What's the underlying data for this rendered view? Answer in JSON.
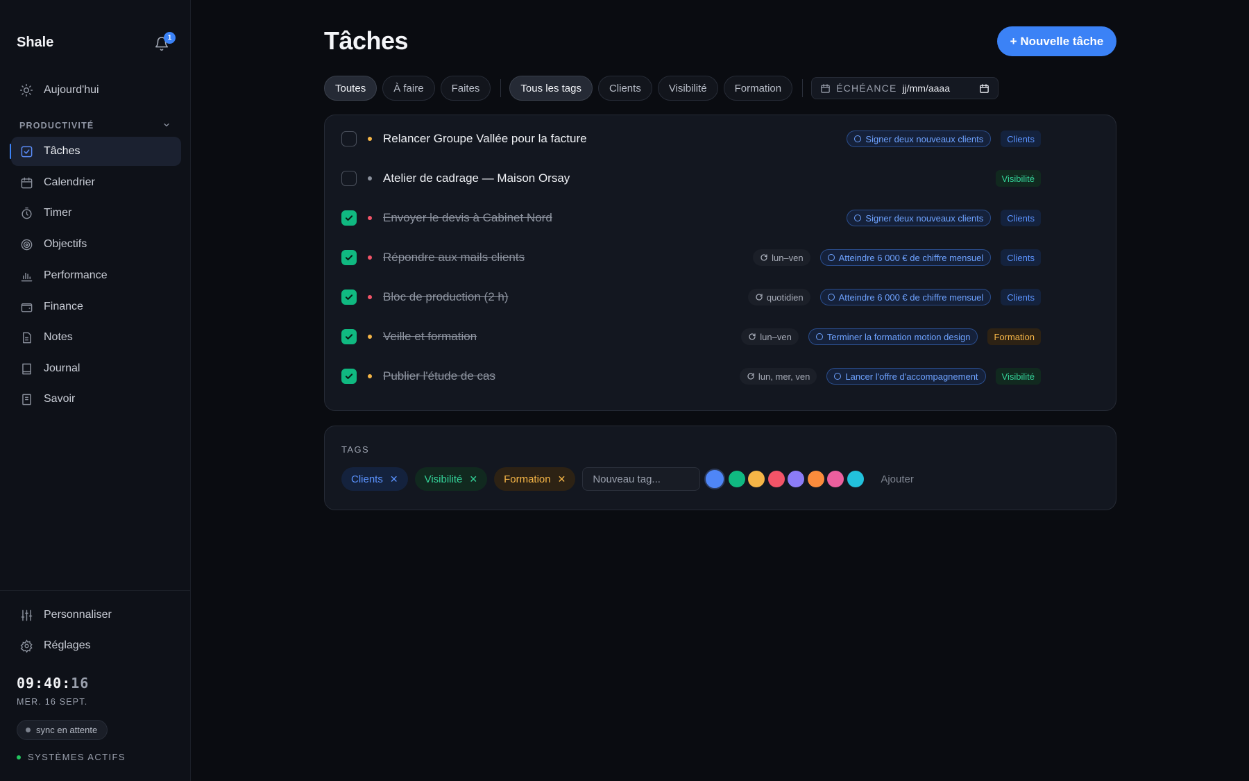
{
  "app": {
    "brand": "Shale",
    "notification_count": "1"
  },
  "sidebar": {
    "top_items": [
      {
        "label": "Aujourd'hui",
        "icon": "sun-icon"
      }
    ],
    "section_label": "PRODUCTIVITÉ",
    "items": [
      {
        "label": "Tâches",
        "icon": "check-square-icon",
        "active": true
      },
      {
        "label": "Calendrier",
        "icon": "calendar-icon"
      },
      {
        "label": "Timer",
        "icon": "stopwatch-icon"
      },
      {
        "label": "Objectifs",
        "icon": "target-icon"
      },
      {
        "label": "Performance",
        "icon": "bar-chart-icon"
      },
      {
        "label": "Finance",
        "icon": "wallet-icon"
      },
      {
        "label": "Notes",
        "icon": "document-icon"
      },
      {
        "label": "Journal",
        "icon": "book-icon"
      },
      {
        "label": "Savoir",
        "icon": "knowledge-icon"
      }
    ],
    "bottom_items": [
      {
        "label": "Personnaliser",
        "icon": "sliders-icon"
      },
      {
        "label": "Réglages",
        "icon": "gear-icon"
      }
    ],
    "clock": {
      "hm": "09:40:",
      "sec": "16"
    },
    "date": "MER. 16 SEPT.",
    "sync_status": "sync en attente",
    "systems_status": "SYSTÈMES ACTIFS"
  },
  "main": {
    "title": "Tâches",
    "new_task_label": "+ Nouvelle tâche",
    "status_filters": [
      "Toutes",
      "À faire",
      "Faites"
    ],
    "tag_filters": [
      "Tous les tags",
      "Clients",
      "Visibilité",
      "Formation"
    ],
    "due_label": "ÉCHÉANCE",
    "due_placeholder": "jj/mm/aaaa"
  },
  "tasks": [
    {
      "title": "Relancer Groupe Vallée pour la facture",
      "done": false,
      "priority_color": "#f5b547",
      "recurrence": "",
      "goal": "Signer deux nouveaux clients",
      "tag": "Clients"
    },
    {
      "title": "Atelier de cadrage — Maison Orsay",
      "done": false,
      "priority_color": "#8a909c",
      "recurrence": "",
      "goal": "",
      "tag": "Visibilité"
    },
    {
      "title": "Envoyer le devis à Cabinet Nord",
      "done": true,
      "priority_color": "#f25468",
      "recurrence": "",
      "goal": "Signer deux nouveaux clients",
      "tag": "Clients"
    },
    {
      "title": "Répondre aux mails clients",
      "done": true,
      "priority_color": "#f25468",
      "recurrence": "lun–ven",
      "goal": "Atteindre 6 000 € de chiffre mensuel",
      "tag": "Clients"
    },
    {
      "title": "Bloc de production (2 h)",
      "done": true,
      "priority_color": "#f25468",
      "recurrence": "quotidien",
      "goal": "Atteindre 6 000 € de chiffre mensuel",
      "tag": "Clients"
    },
    {
      "title": "Veille et formation",
      "done": true,
      "priority_color": "#f5b547",
      "recurrence": "lun–ven",
      "goal": "Terminer la formation motion design",
      "tag": "Formation"
    },
    {
      "title": "Publier l'étude de cas",
      "done": true,
      "priority_color": "#f5b547",
      "recurrence": "lun, mer, ven",
      "goal": "Lancer l'offre d'accompagnement",
      "tag": "Visibilité"
    }
  ],
  "tags_panel": {
    "title": "TAGS",
    "tags": [
      {
        "label": "Clients",
        "color": "#5b93ff"
      },
      {
        "label": "Visibilité",
        "color": "#34d399"
      },
      {
        "label": "Formation",
        "color": "#f5b547"
      }
    ],
    "new_tag_placeholder": "Nouveau tag...",
    "swatches": [
      "#4f86f7",
      "#10b981",
      "#f5b547",
      "#f25468",
      "#8b7cf6",
      "#fb8c3c",
      "#ec5f9e",
      "#22c1dc"
    ],
    "selected_swatch": 0,
    "add_label": "Ajouter"
  },
  "colors": {
    "accent": "#3b82f6",
    "done_check": "#10b981"
  }
}
